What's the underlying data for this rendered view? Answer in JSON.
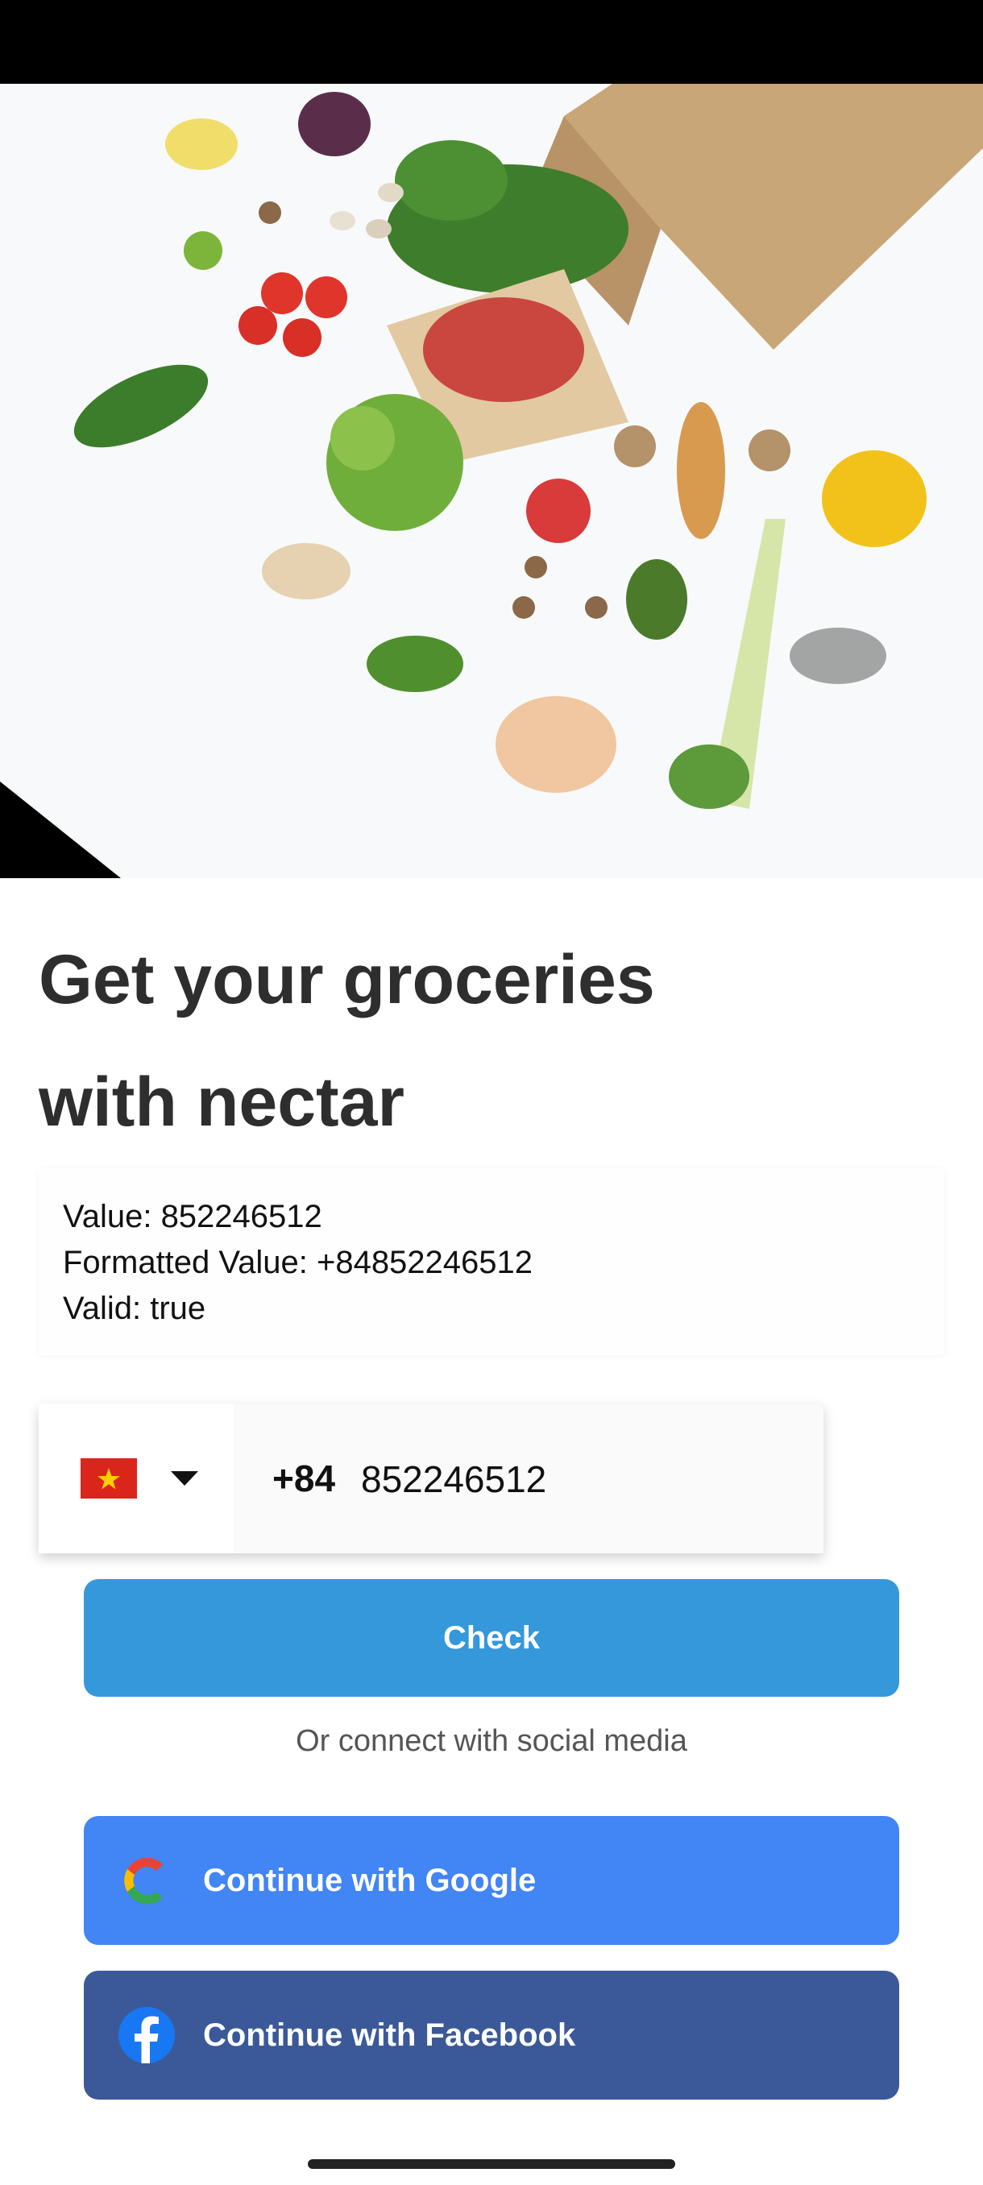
{
  "header": {
    "title_line1": "Get your groceries",
    "title_line2": "with nectar"
  },
  "phone_info": {
    "value": "Value: 852246512",
    "formatted": "Formatted Value: +84852246512",
    "valid": "Valid: true"
  },
  "phone_input": {
    "country_flag": "vietnam-flag",
    "dial_code": "+84",
    "value": "852246512"
  },
  "actions": {
    "check_label": "Check",
    "social_caption": "Or connect with social media",
    "google_label": "Continue with Google",
    "facebook_label": "Continue with Facebook"
  },
  "colors": {
    "check_button": "#3498db",
    "google_button": "#4285f4",
    "facebook_button": "#3b5998"
  }
}
